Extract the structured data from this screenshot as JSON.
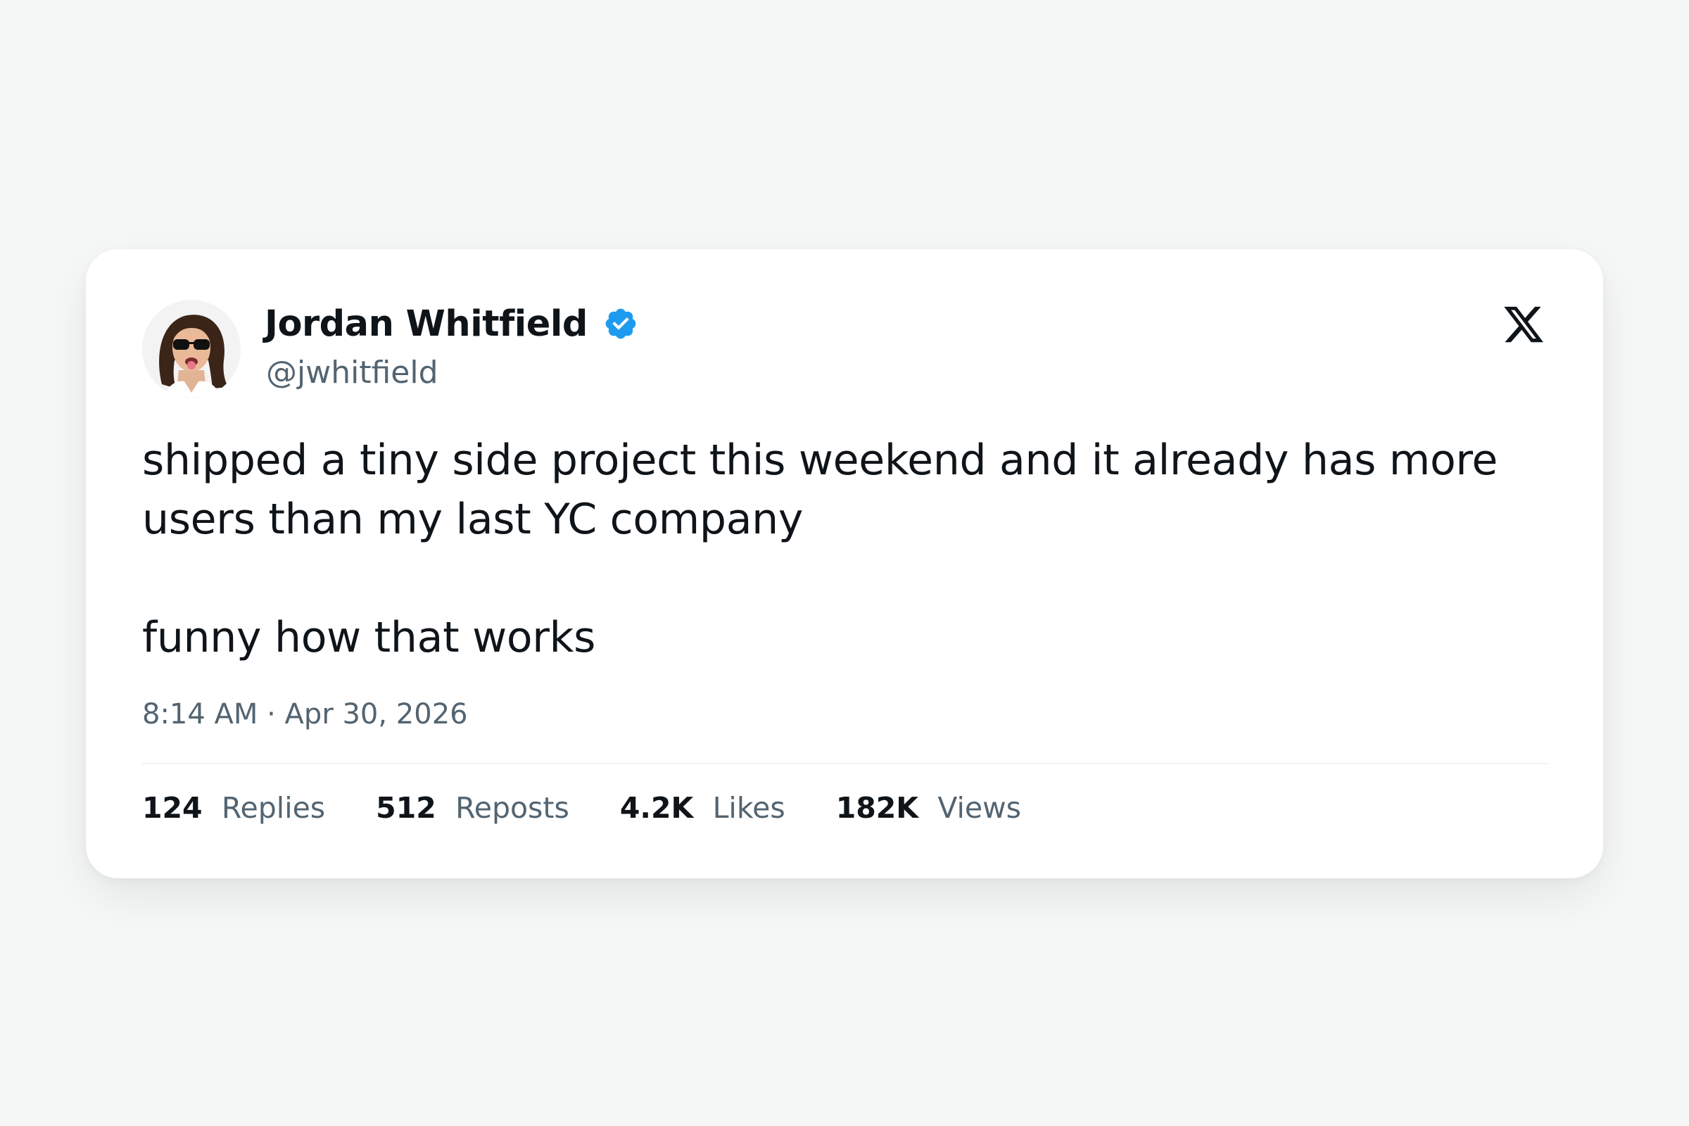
{
  "tweet": {
    "author": {
      "name": "Jordan Whitfield",
      "handle": "@jwhitfield",
      "verified": true,
      "avatar_icon": "profile-photo-sunglasses"
    },
    "brand_icon": "x-logo-icon",
    "text_lines": [
      "shipped a tiny side project this weekend and it already has more users than my last YC company",
      "funny how that works"
    ],
    "timestamp": "8:14 AM · Apr 30, 2026",
    "stats": [
      {
        "value": "124",
        "label": "Replies"
      },
      {
        "value": "512",
        "label": "Reposts"
      },
      {
        "value": "4.2K",
        "label": "Likes"
      },
      {
        "value": "182K",
        "label": "Views"
      }
    ]
  },
  "colors": {
    "page_background": "#f6f7f7",
    "card_background": "#ffffff",
    "primary_text": "#0f1419",
    "secondary_text": "#536471",
    "verified_blue": "#1d9bf0"
  }
}
